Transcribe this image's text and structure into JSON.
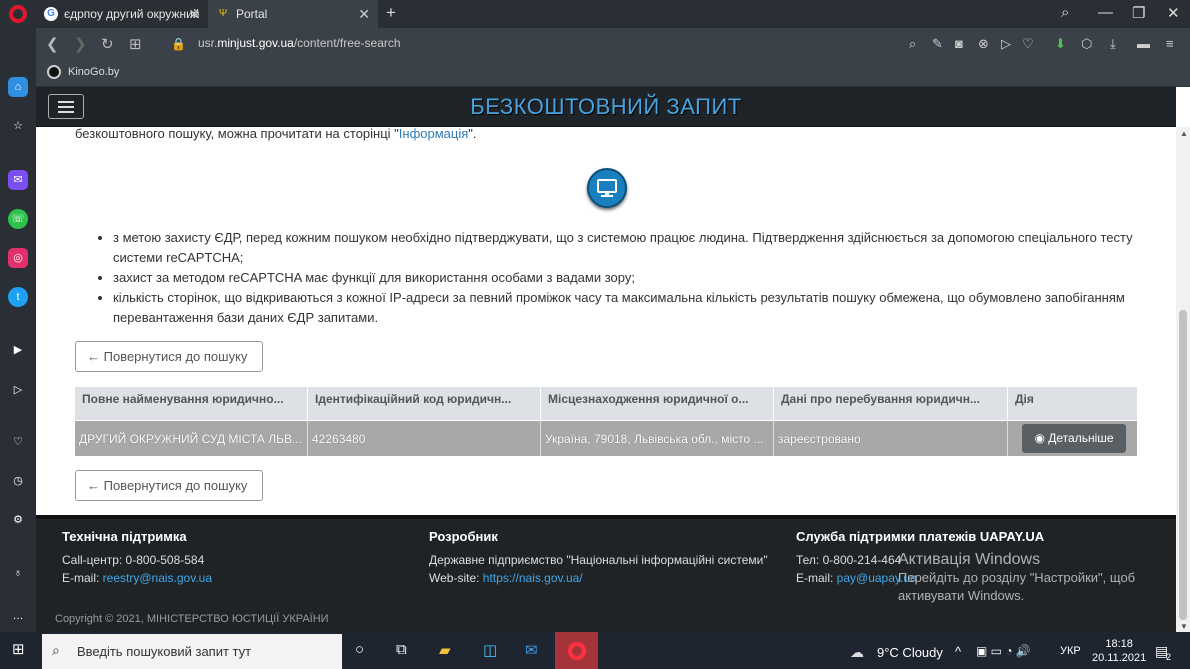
{
  "browser": {
    "tabs": [
      {
        "title": "єдрпоу другий окружний",
        "active": false
      },
      {
        "title": "Portal",
        "active": true
      }
    ],
    "url_prefix": "usr.",
    "url_domain": "minjust.gov.ua",
    "url_path": "/content/free-search",
    "bookmark": "KinoGo.by"
  },
  "header": {
    "title": "БЕЗКОШТОВНИЙ ЗАПИТ"
  },
  "intro": {
    "text": "безкоштовного пошуку, можна прочитати на сторінці \"",
    "link": "Інформація",
    "tail": "\"."
  },
  "bullets": [
    "з метою захисту ЄДР, перед кожним пошуком необхідно підтверджувати, що з системою працює людина. Підтвердження здійснюється за допомогою спеціального тесту системи reCAPTCHA;",
    "захист за методом reCAPTCHA має функції для використання особами з вадами зору;",
    "кількість сторінок, що відкриваються з кожної IP-адреси за певний проміжок часу та максимальна кількість результатів пошуку обмежена, що обумовлено запобіганням перевантаження бази даних ЄДР запитами."
  ],
  "back_button": "← Повернутися до пошуку",
  "table": {
    "headers": [
      "Повне найменування юридично...",
      "Ідентифікаційний код юридичн...",
      "Місцезнаходження юридичної о...",
      "Дані про перебування юридичн...",
      "Дія"
    ],
    "rows": [
      [
        "ДРУГИЙ ОКРУЖНИЙ СУД МІСТА ЛЬВ...",
        "42263480",
        "Україна, 79018, Львівська обл., місто ...",
        "зареєстровано"
      ]
    ],
    "action_label": "Детальніше"
  },
  "footer": {
    "support_title": "Технічна підтримка",
    "support_phone": "Call-центр: 0-800-508-584",
    "support_email_label": "E-mail: ",
    "support_email": "reestry@nais.gov.ua",
    "dev_title": "Розробник",
    "dev_name": "Державне підприємство \"Національні інформаційні системи\"",
    "dev_web_label": "Web-site: ",
    "dev_web": "https://nais.gov.ua/",
    "pay_title": "Служба підтримки платежів UAPAY.UA",
    "pay_phone": "Тел: 0-800-214-464",
    "pay_email_label": "E-mail: ",
    "pay_email": "pay@uapay.ua",
    "copyright": "Copyright © 2021, МІНІСТЕРСТВО ЮСТИЦІЇ УКРАЇНИ"
  },
  "watermark": {
    "title": "Активація Windows",
    "line1": "Перейдіть до розділу \"Настройки\", щоб",
    "line2": "активувати Windows."
  },
  "taskbar": {
    "search_placeholder": "Введіть пошуковий запит тут",
    "weather": "9°C  Cloudy",
    "lang": "УКР",
    "time": "18:18",
    "date": "20.11.2021",
    "notif": "2"
  }
}
